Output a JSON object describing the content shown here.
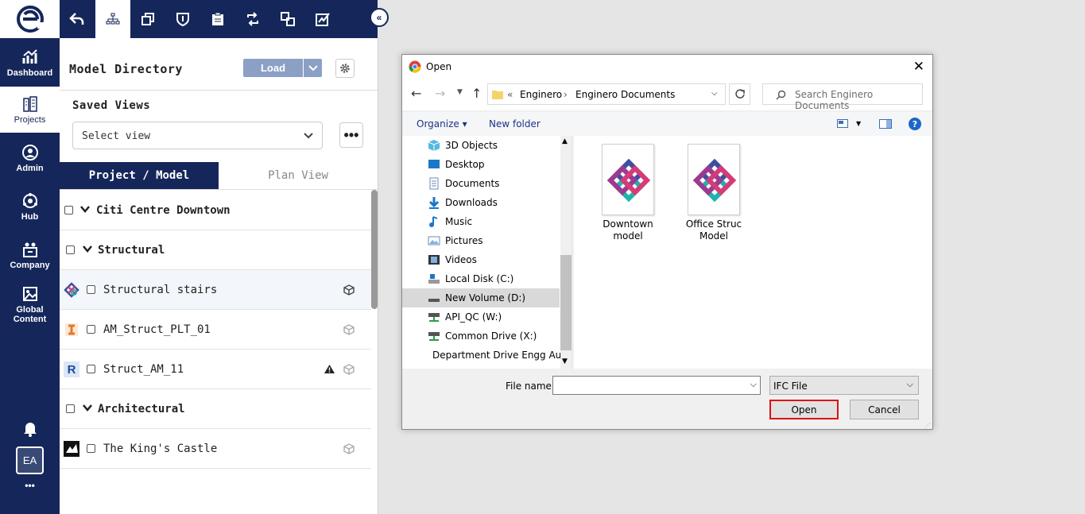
{
  "nav": {
    "items": [
      {
        "label": "Dashboard",
        "icon": "dashboard-icon"
      },
      {
        "label": "Projects",
        "icon": "projects-icon"
      },
      {
        "label": "Admin",
        "icon": "admin-icon"
      },
      {
        "label": "Hub",
        "icon": "hub-icon"
      },
      {
        "label": "Company",
        "icon": "company-icon"
      },
      {
        "label": "Global Content",
        "icon": "global-content-icon"
      }
    ],
    "avatar": "EA",
    "more": "•••"
  },
  "panel": {
    "title": "Model Directory",
    "load_label": "Load",
    "saved_views_title": "Saved Views",
    "select_view_placeholder": "Select view",
    "more_label": "•••",
    "tabs": [
      "Project / Model",
      "Plan View"
    ],
    "collapse_label": "«",
    "rows": [
      {
        "label": "Citi Centre Downtown",
        "type": "group"
      },
      {
        "label": "Structural",
        "type": "group"
      },
      {
        "label": "Structural stairs",
        "type": "model",
        "icon": "ifc-icon"
      },
      {
        "label": "AM_Struct_PLT_01",
        "type": "model",
        "icon": "i-beam-icon"
      },
      {
        "label": "Struct_AM_11",
        "type": "model",
        "icon": "revit-icon",
        "warning": true,
        "letter": "R"
      },
      {
        "label": "Architectural",
        "type": "group"
      },
      {
        "label": "The King's Castle",
        "type": "model",
        "icon": "castle-icon"
      }
    ]
  },
  "dialog": {
    "title": "Open",
    "breadcrumb": [
      "«",
      "Enginero",
      "Enginero Documents"
    ],
    "search_placeholder": "Search Enginero Documents",
    "organize_label": "Organize ▾",
    "new_folder_label": "New folder",
    "help_label": "?",
    "tree": [
      "3D Objects",
      "Desktop",
      "Documents",
      "Downloads",
      "Music",
      "Pictures",
      "Videos",
      "Local Disk (C:)",
      "New Volume (D:)",
      "API_QC (W:)",
      "Common Drive (X:)",
      "Department Drive Engg Aut"
    ],
    "files": [
      {
        "name_line1": "Downtown",
        "name_line2": "model"
      },
      {
        "name_line1": "Office Struc",
        "name_line2": "Model"
      }
    ],
    "file_name_label": "File name:",
    "file_name_value": "",
    "file_type_value": "IFC File",
    "open_label": "Open",
    "cancel_label": "Cancel"
  },
  "colors": {
    "nav_bg": "#15275a",
    "load_btn": "#8ba0c4",
    "highlight": "#e01010"
  }
}
